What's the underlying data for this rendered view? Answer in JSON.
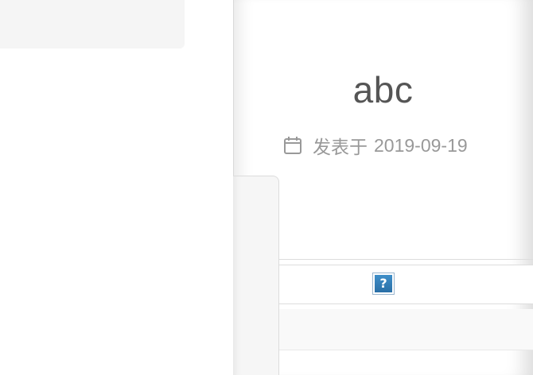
{
  "post": {
    "title": "abc",
    "meta_label": "发表于",
    "date": "2019-09-19",
    "date_icon": "calendar-icon"
  },
  "content": {
    "image_placeholder": "?",
    "image_icon": "broken-image-icon"
  }
}
